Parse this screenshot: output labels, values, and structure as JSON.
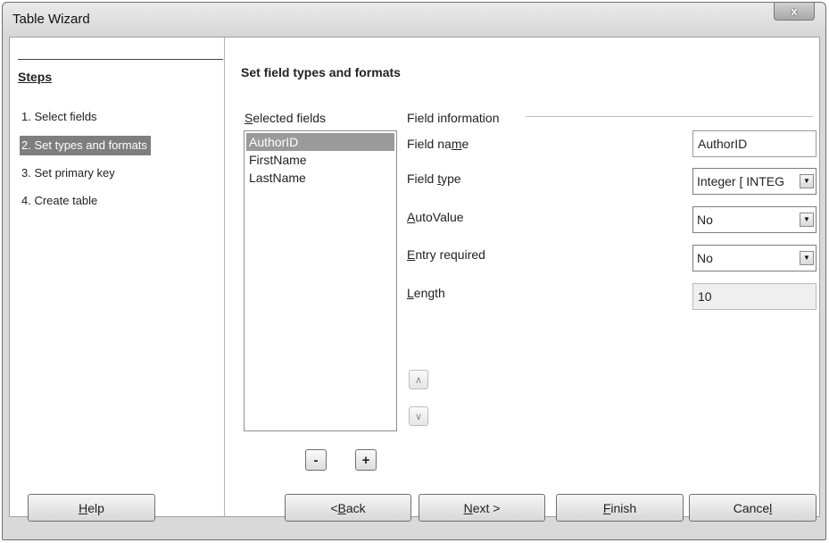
{
  "window": {
    "title": "Table Wizard",
    "close_glyph": "x"
  },
  "steps": {
    "title": "Steps",
    "items": [
      {
        "label": "1. Select fields"
      },
      {
        "label": "2. Set types and formats",
        "active": true
      },
      {
        "label": "3. Set primary key"
      },
      {
        "label": "4. Create table"
      }
    ]
  },
  "main": {
    "title": "Set field types and formats",
    "selected_fields": {
      "label": "Selected fields",
      "items": [
        "AuthorID",
        "FirstName",
        "LastName"
      ],
      "selected": "AuthorID",
      "remove_label": "-",
      "add_label": "+"
    },
    "move_up_glyph": "∧",
    "move_down_glyph": "∨",
    "field_info": {
      "group_label": "Field information",
      "field_name_label": "Field name",
      "field_name_value": "AuthorID",
      "field_type_label": "Field type",
      "field_type_value": "Integer [ INTEG",
      "autovalue_label": "AutoValue",
      "autovalue_value": "No",
      "entry_required_label": "Entry required",
      "entry_required_value": "No",
      "length_label": "Length",
      "length_value": "10"
    }
  },
  "footer": {
    "help": "Help",
    "back": "< Back",
    "next": "Next >",
    "finish": "Finish",
    "cancel": "Cancel"
  },
  "icons": {
    "close": "close-icon",
    "dropdown": "chevron-down-icon",
    "move_up": "chevron-up-icon",
    "move_down": "chevron-down-icon"
  },
  "colors": {
    "selection": "#7e7e7e",
    "list_selection": "#9a9a9a",
    "window_bg": "#d9d9d9"
  }
}
